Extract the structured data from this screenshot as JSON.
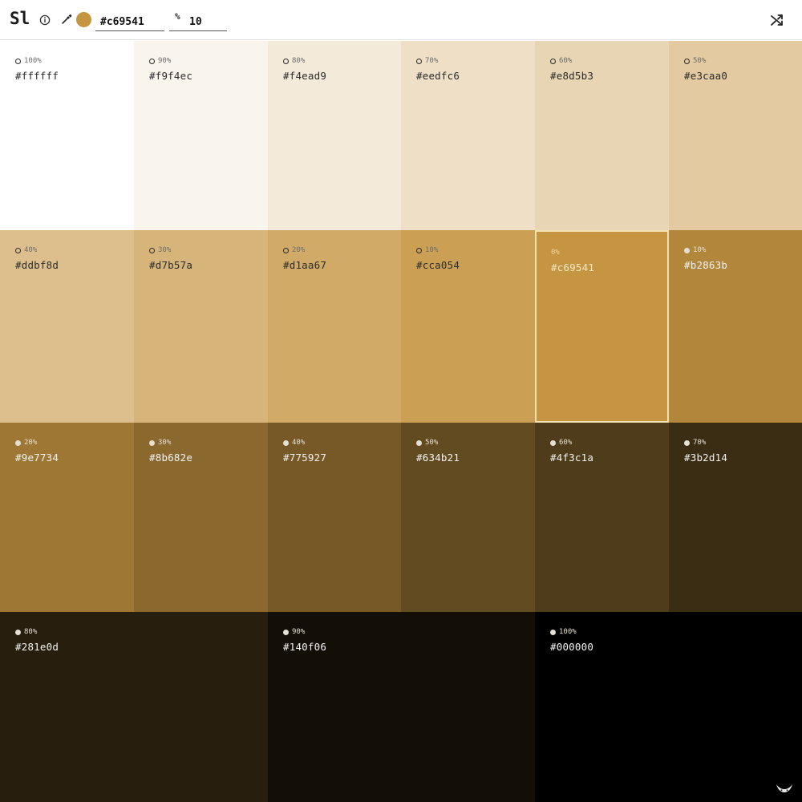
{
  "app": {
    "logo": "Sl"
  },
  "toolbar": {
    "info_icon": "info-icon",
    "picker_icon": "eyedropper-icon",
    "swatch_color": "#c69541",
    "hex_value": "#c69541",
    "step_icon_glyph": "%",
    "step_value": "10",
    "shuffle_icon": "shuffle-icon"
  },
  "palette": [
    {
      "pct": "100%",
      "hex": "#ffffff",
      "kind": "tint",
      "bg": "#ffffff",
      "fg": "#2b2b2b",
      "muted": "#6d6d6d"
    },
    {
      "pct": "90%",
      "hex": "#f9f4ec",
      "kind": "tint",
      "bg": "#f9f4ec",
      "fg": "#2b2b2b",
      "muted": "#6d6d6d"
    },
    {
      "pct": "80%",
      "hex": "#f4ead9",
      "kind": "tint",
      "bg": "#f4ead9",
      "fg": "#2b2b2b",
      "muted": "#6d6d6d"
    },
    {
      "pct": "70%",
      "hex": "#eedfc6",
      "kind": "tint",
      "bg": "#eedfc6",
      "fg": "#2b2b2b",
      "muted": "#6d6d6d"
    },
    {
      "pct": "60%",
      "hex": "#e8d5b3",
      "kind": "tint",
      "bg": "#e8d5b3",
      "fg": "#2b2b2b",
      "muted": "#6d6d6d"
    },
    {
      "pct": "50%",
      "hex": "#e3caa0",
      "kind": "tint",
      "bg": "#e3caa0",
      "fg": "#2b2b2b",
      "muted": "#6d6d6d"
    },
    {
      "pct": "40%",
      "hex": "#ddbf8d",
      "kind": "tint",
      "bg": "#ddbf8d",
      "fg": "#2b2b2b",
      "muted": "#6d6d6d"
    },
    {
      "pct": "30%",
      "hex": "#d7b57a",
      "kind": "tint",
      "bg": "#d7b57a",
      "fg": "#2b2b2b",
      "muted": "#6d6d6d"
    },
    {
      "pct": "20%",
      "hex": "#d1aa67",
      "kind": "tint",
      "bg": "#d1aa67",
      "fg": "#2b2b2b",
      "muted": "#6d6d6d"
    },
    {
      "pct": "10%",
      "hex": "#cca054",
      "kind": "tint",
      "bg": "#cca054",
      "fg": "#2b2b2b",
      "muted": "#6d6d6d"
    },
    {
      "pct": "0%",
      "hex": "#c69541",
      "kind": "base",
      "bg": "#c69541",
      "fg": "#f7e8c6",
      "muted": "#ecd6a8"
    },
    {
      "pct": "10%",
      "hex": "#b2863b",
      "kind": "shade",
      "bg": "#b2863b",
      "fg": "#f3f3f3",
      "muted": "#e5e0d4"
    },
    {
      "pct": "20%",
      "hex": "#9e7734",
      "kind": "shade",
      "bg": "#9e7734",
      "fg": "#f3f3f3",
      "muted": "#e5e0d4"
    },
    {
      "pct": "30%",
      "hex": "#8b682e",
      "kind": "shade",
      "bg": "#8b682e",
      "fg": "#f3f3f3",
      "muted": "#e5e0d4"
    },
    {
      "pct": "40%",
      "hex": "#775927",
      "kind": "shade",
      "bg": "#775927",
      "fg": "#f3f3f3",
      "muted": "#e5e0d4"
    },
    {
      "pct": "50%",
      "hex": "#634b21",
      "kind": "shade",
      "bg": "#634b21",
      "fg": "#f3f3f3",
      "muted": "#e5e0d4"
    },
    {
      "pct": "60%",
      "hex": "#4f3c1a",
      "kind": "shade",
      "bg": "#4f3c1a",
      "fg": "#f3f3f3",
      "muted": "#e5e0d4"
    },
    {
      "pct": "70%",
      "hex": "#3b2d14",
      "kind": "shade",
      "bg": "#3b2d14",
      "fg": "#f3f3f3",
      "muted": "#e5e0d4"
    },
    {
      "pct": "80%",
      "hex": "#281e0d",
      "kind": "shade",
      "bg": "#281e0d",
      "fg": "#f3f3f3",
      "muted": "#e5e0d4"
    },
    {
      "pct": "90%",
      "hex": "#140f06",
      "kind": "shade",
      "bg": "#140f06",
      "fg": "#f3f3f3",
      "muted": "#e5e0d4"
    },
    {
      "pct": "100%",
      "hex": "#000000",
      "kind": "shade",
      "bg": "#000000",
      "fg": "#f3f3f3",
      "muted": "#e5e0d4"
    }
  ],
  "selected_index": 10,
  "brand_icon": "brand-mark-icon"
}
